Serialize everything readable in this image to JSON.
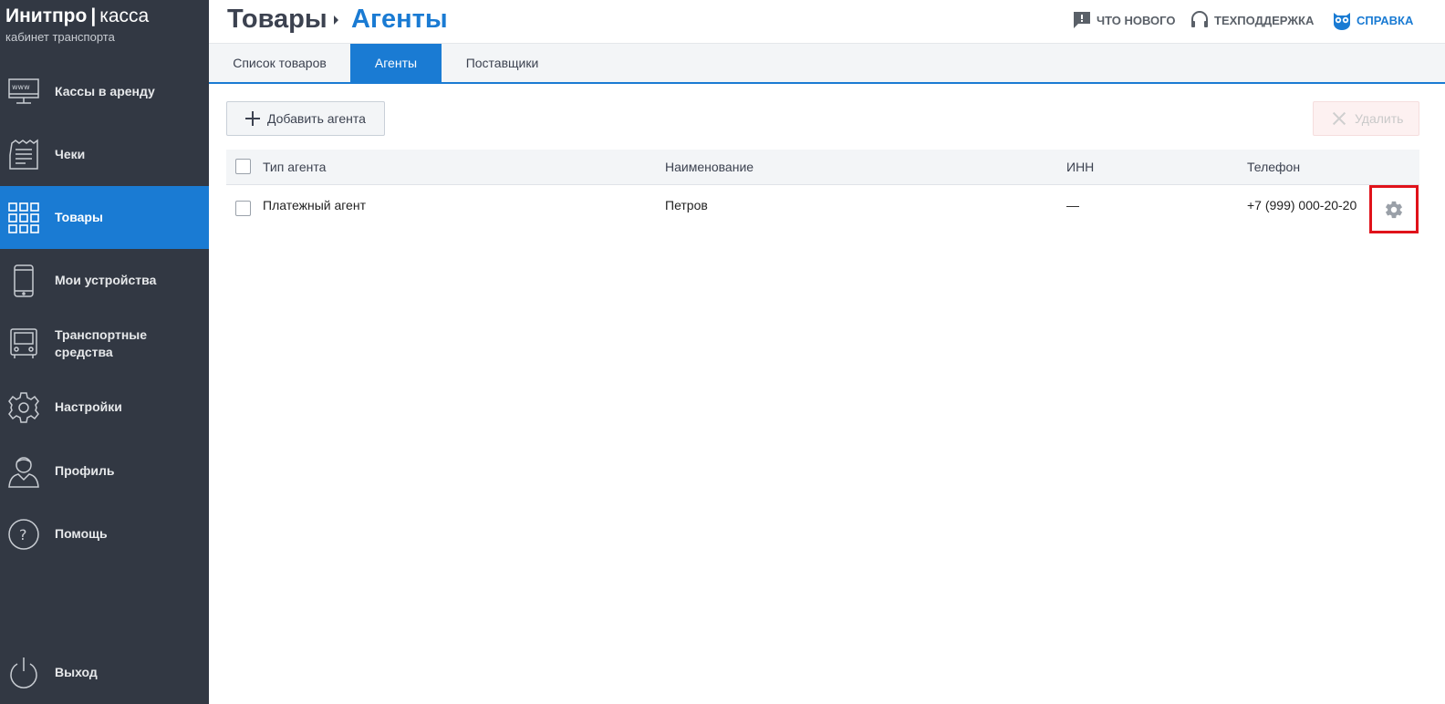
{
  "brand": {
    "name": "Инитпро",
    "separator": "|",
    "product": "касса",
    "subtitle": "кабинет транспорта"
  },
  "sidebar": {
    "items": [
      {
        "label": "Кассы в аренду",
        "icon": "monitor-www-icon"
      },
      {
        "label": "Чеки",
        "icon": "receipt-icon"
      },
      {
        "label": "Товары",
        "icon": "grid-icon",
        "active": true
      },
      {
        "label": "Мои устройства",
        "icon": "smartphone-icon"
      },
      {
        "label": "Транспортные средства",
        "icon": "bus-icon"
      },
      {
        "label": "Настройки",
        "icon": "gear-icon"
      },
      {
        "label": "Профиль",
        "icon": "user-icon"
      },
      {
        "label": "Помощь",
        "icon": "question-icon"
      },
      {
        "label": "Выход",
        "icon": "power-icon"
      }
    ]
  },
  "header": {
    "breadcrumb_root": "Товары",
    "breadcrumb_current": "Агенты",
    "links": {
      "whats_new": "Что нового",
      "support": "Техподдержка",
      "help": "Справка"
    }
  },
  "tabs": [
    {
      "label": "Список товаров"
    },
    {
      "label": "Агенты",
      "active": true
    },
    {
      "label": "Поставщики"
    }
  ],
  "toolbar": {
    "add_label": "Добавить агента",
    "delete_label": "Удалить"
  },
  "table": {
    "columns": [
      "Тип агента",
      "Наименование",
      "ИНН",
      "Телефон"
    ],
    "rows": [
      {
        "type": "Платежный агент",
        "name": "Петров",
        "inn": "—",
        "phone": "+7 (999) 000-20-20"
      }
    ]
  },
  "colors": {
    "accent": "#1a7bd3",
    "sidebar_bg": "#323843",
    "highlight_border": "#e0121a"
  }
}
